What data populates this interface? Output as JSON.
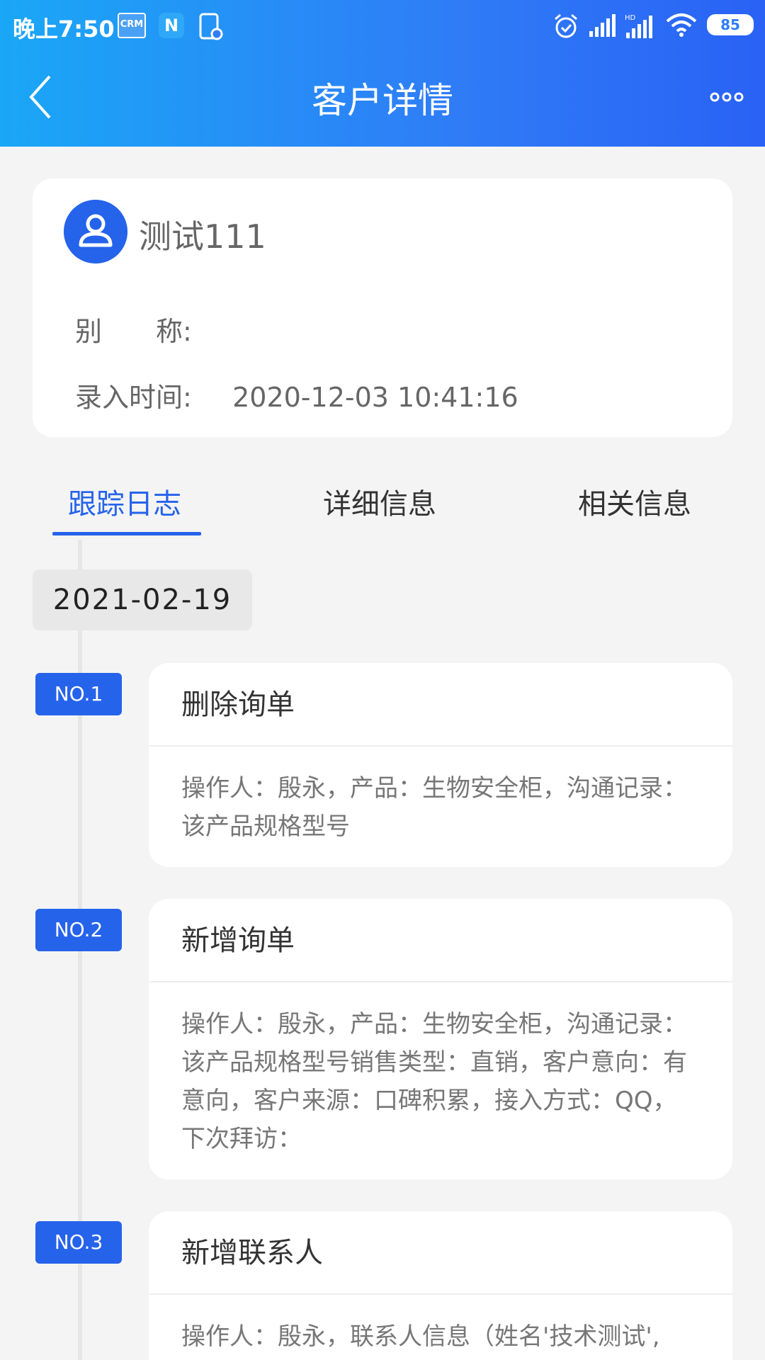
{
  "status_bar": {
    "time": "晚上7:50",
    "crm_label": "CRM",
    "n_label": "N",
    "battery": "85"
  },
  "nav": {
    "title": "客户详情"
  },
  "customer": {
    "name": "测试111",
    "alias_label": "别　　称:",
    "alias_value": "",
    "created_label": "录入时间:",
    "created_value": "2020-12-03 10:41:16"
  },
  "tabs": [
    {
      "label": "跟踪日志",
      "active": true
    },
    {
      "label": "详细信息",
      "active": false
    },
    {
      "label": "相关信息",
      "active": false
    }
  ],
  "timeline": {
    "date": "2021-02-19",
    "items": [
      {
        "badge": "NO.1",
        "title": "删除询单",
        "body": "操作人：殷永，产品：生物安全柜，沟通记录：该产品规格型号"
      },
      {
        "badge": "NO.2",
        "title": "新增询单",
        "body": "操作人：殷永，产品：生物安全柜，沟通记录：该产品规格型号销售类型：直销，客户意向：有意向，客户来源：口碑积累，接入方式：QQ，下次拜访："
      },
      {
        "badge": "NO.3",
        "title": "新增联系人",
        "body": "操作人：殷永，联系人信息（姓名'技术测试',"
      }
    ]
  },
  "colors": {
    "accent": "#2563eb",
    "header_start": "#1aa7f6",
    "header_end": "#2962f5"
  }
}
